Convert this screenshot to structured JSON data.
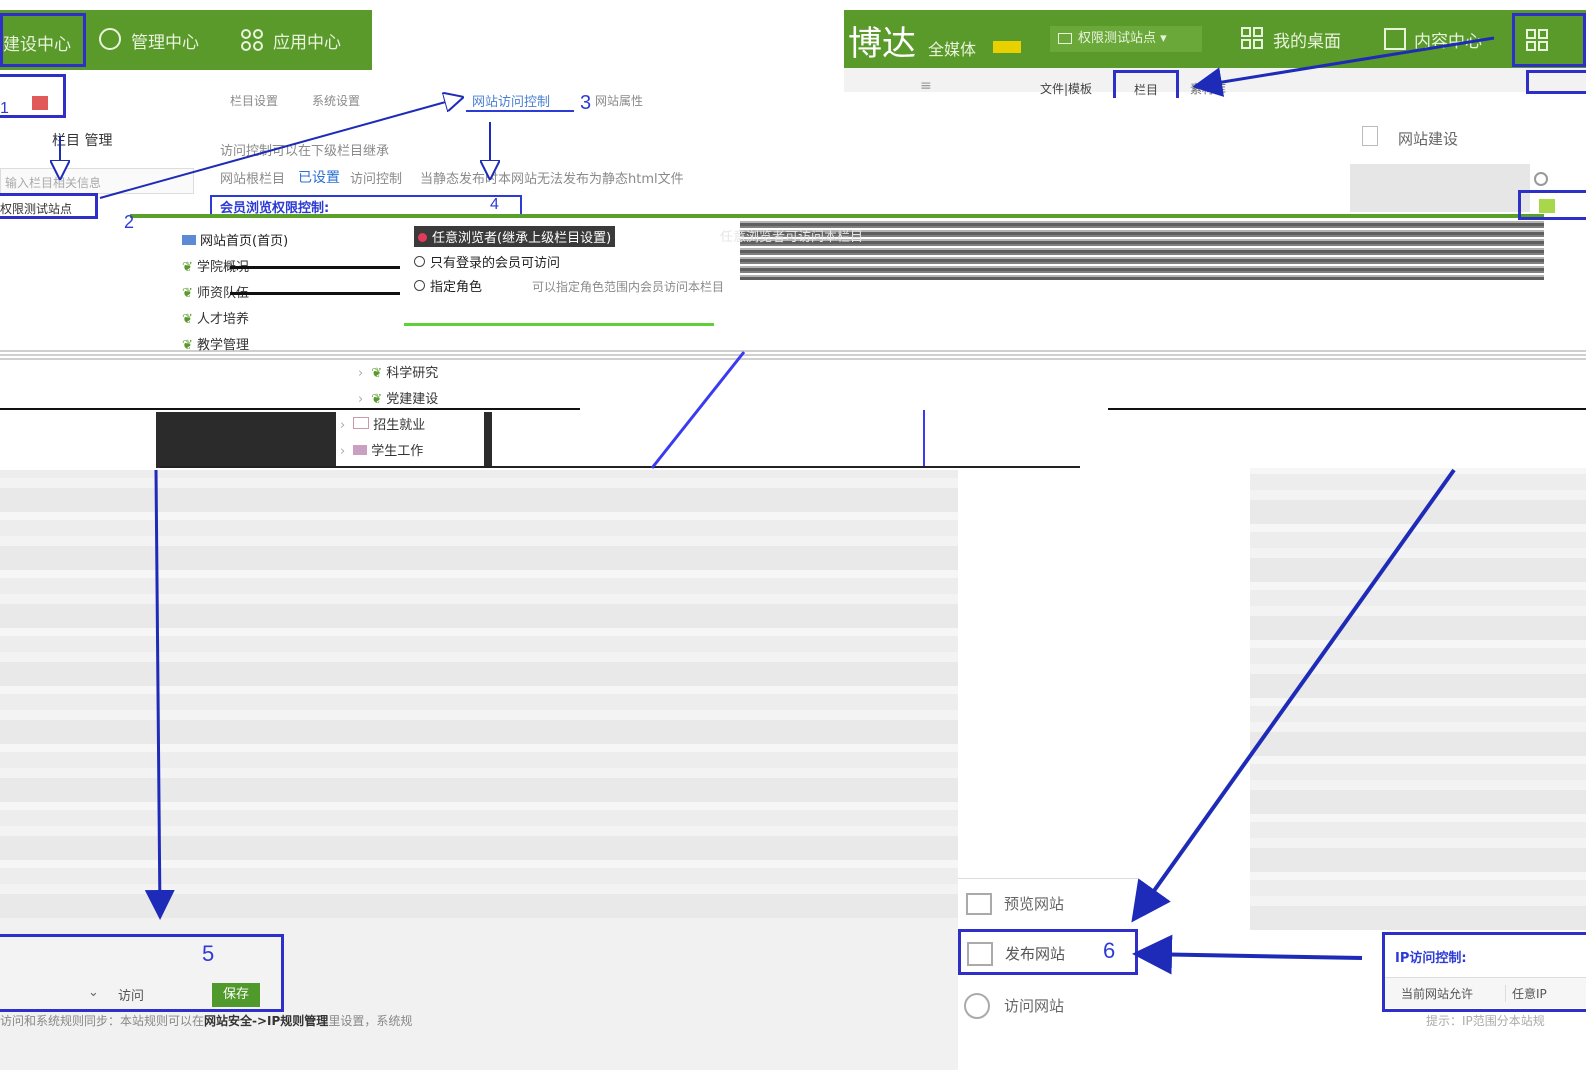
{
  "colors": {
    "brand_green": "#5a9a2a",
    "annotation_blue": "#2d3bd6",
    "warning_red": "#d62222"
  },
  "left_nav": {
    "items": [
      "建设中心",
      "管理中心",
      "应用中心"
    ],
    "icons": [
      "gear-icon",
      "apps-icon"
    ]
  },
  "right_nav": {
    "logo": "博达",
    "logo_sub": "全媒体",
    "site_select": "权限测试站点",
    "items": [
      "我的桌面",
      "内容中心"
    ],
    "icons": [
      "desktop-grid-icon",
      "content-icon",
      "apps-icon"
    ]
  },
  "top_tabs": {
    "file_template": "文件|模板",
    "column": "栏目",
    "other": "素材库"
  },
  "left_panel": {
    "column_manage": "栏目 管理",
    "search_placeholder": "输入栏目相关信息",
    "site_root": "权限测试站点"
  },
  "settings_tabs": [
    "栏目设置",
    "系统设置",
    "网站访问控制",
    "网站属性"
  ],
  "access": {
    "note": "访问控制可以在下级栏目继承",
    "root_label": "网站根栏目",
    "root_status": "已设置",
    "root_mode": "访问控制",
    "root_hint": "当静态发布时本网站无法发布为静态html文件",
    "member_header": "会员浏览权限控制:",
    "options": [
      "任意浏览者(继承上级栏目设置)",
      "只有登录的会员可访问",
      "指定角色"
    ],
    "option_note": "任意浏览者可访问本栏目",
    "role_note": "可以指定角色范围内会员访问本栏目"
  },
  "tree": {
    "items": [
      "网站首页(首页)",
      "学院概况",
      "师资队伍",
      "人才培养",
      "教学管理",
      "科学研究",
      "党建建设",
      "招生就业",
      "学生工作"
    ]
  },
  "website_build": "网站建设",
  "bottom_left": {
    "action": "访问",
    "save": "保存",
    "hint": "访问和系统规则同步：本站规则可以在",
    "hint_bold": "网站安全->IP规则管理",
    "hint_tail": "里设置，系统规"
  },
  "publish_menu": {
    "preview": "预览网站",
    "publish": "发布网站",
    "visit": "访问网站"
  },
  "ip_panel": {
    "title": "IP访问控制:",
    "current": "当前网站允许",
    "any": "任意IP",
    "tip": "提示：IP范围分本站规"
  },
  "steps": [
    "1",
    "2",
    "3",
    "4",
    "5",
    "6"
  ]
}
